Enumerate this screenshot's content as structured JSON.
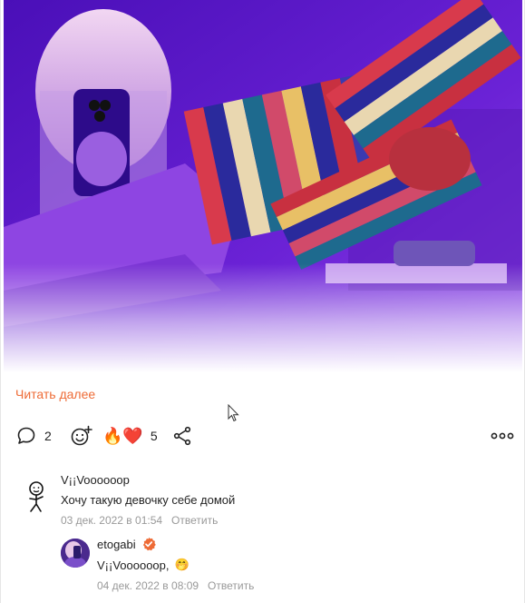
{
  "post": {
    "read_more": "Читать далее"
  },
  "actions": {
    "comments_count": "2",
    "reactions_emoji": "🔥❤️",
    "reactions_count": "5"
  },
  "icons": {
    "comment": "comment-bubble-icon",
    "add_reaction": "add-reaction-smile-icon",
    "share": "share-icon",
    "more": "more-dots-icon",
    "cursor": "mouse-pointer-icon",
    "verified": "verified-badge-icon"
  },
  "comments": [
    {
      "author": "V¡¡Voooooop",
      "text": "Хочу такую девочку себе домой",
      "date": "03 дек. 2022 в 01:54",
      "reply_label": "Ответить"
    },
    {
      "author": "etogabi",
      "text": "V¡¡Voooooop,",
      "emoji": "🤭",
      "date": "04 дек. 2022 в 08:09",
      "reply_label": "Ответить"
    }
  ],
  "colors": {
    "accent": "#ee6b36",
    "verified": "#ee6b36",
    "photo_bg": "#5a16c8",
    "muted": "#999999"
  }
}
